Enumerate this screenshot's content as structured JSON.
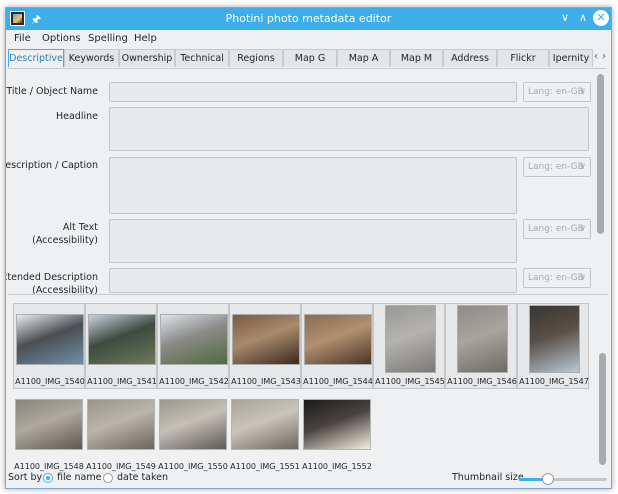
{
  "window": {
    "title": "Photini photo metadata editor",
    "pin_icon": "pin-icon",
    "app_icon": "photini-app-icon"
  },
  "menu": {
    "items": [
      "File",
      "Options",
      "Spelling",
      "Help"
    ]
  },
  "tabs": {
    "items": [
      "Descriptive",
      "Keywords",
      "Ownership",
      "Technical",
      "Regions",
      "Map G",
      "Map A",
      "Map M",
      "Address",
      "Flickr",
      "Ipernity"
    ],
    "active": "Descriptive"
  },
  "form": {
    "fields": [
      {
        "label": "Title / Object Name",
        "value": "",
        "lang": "Lang: en-GB"
      },
      {
        "label": "Headline",
        "value": ""
      },
      {
        "label": "Description / Caption",
        "value": "",
        "lang": "Lang: en-GB"
      },
      {
        "label": "Alt Text",
        "label2": "(Accessibility)",
        "value": "",
        "lang": "Lang: en-GB"
      },
      {
        "label": "Extended Description",
        "label2": "(Accessibility)",
        "value": "",
        "lang": "Lang: en-GB"
      }
    ]
  },
  "thumbnails": [
    {
      "name": "A1100_IMG_1540",
      "orientation": "landscape",
      "colors": [
        "#e8eaec",
        "#6e8fa8",
        "#4a4f52"
      ]
    },
    {
      "name": "A1100_IMG_1541",
      "orientation": "landscape",
      "colors": [
        "#c8d2dc",
        "#6b7a58",
        "#3e4a40"
      ]
    },
    {
      "name": "A1100_IMG_1542",
      "orientation": "landscape",
      "colors": [
        "#dde3ea",
        "#4f6a3c",
        "#8a8a86"
      ]
    },
    {
      "name": "A1100_IMG_1543",
      "orientation": "landscape",
      "colors": [
        "#7a5a44",
        "#3a2a20",
        "#a88a6c"
      ]
    },
    {
      "name": "A1100_IMG_1544",
      "orientation": "landscape",
      "colors": [
        "#8a6a52",
        "#4a3526",
        "#b09070"
      ]
    },
    {
      "name": "A1100_IMG_1545",
      "orientation": "portrait",
      "colors": [
        "#9a9894",
        "#7c7a76",
        "#b4b2ae"
      ]
    },
    {
      "name": "A1100_IMG_1546",
      "orientation": "portrait",
      "colors": [
        "#8e8a84",
        "#6e6a64",
        "#a8a49e"
      ]
    },
    {
      "name": "A1100_IMG_1547",
      "orientation": "portrait",
      "colors": [
        "#3a3430",
        "#b8c8d4",
        "#5a5048"
      ]
    },
    {
      "name": "A1100_IMG_1548",
      "orientation": "landscape",
      "colors": [
        "#8a847c",
        "#5e5850",
        "#b0a89e"
      ]
    },
    {
      "name": "A1100_IMG_1549",
      "orientation": "landscape",
      "colors": [
        "#9a948a",
        "#6a645c",
        "#bab4aa"
      ]
    },
    {
      "name": "A1100_IMG_1550",
      "orientation": "landscape",
      "colors": [
        "#9a968e",
        "#5e5a54",
        "#c4c0b8"
      ]
    },
    {
      "name": "A1100_IMG_1551",
      "orientation": "landscape",
      "colors": [
        "#a8a49c",
        "#6c6860",
        "#c8c4bc"
      ]
    },
    {
      "name": "A1100_IMG_1552",
      "orientation": "landscape",
      "colors": [
        "#1c1a18",
        "#f4f0e0",
        "#4a4440"
      ]
    }
  ],
  "status": {
    "sort_label": "Sort by",
    "sort_options": [
      "file name",
      "date taken"
    ],
    "sort_selected": "file name",
    "thumb_size_label": "Thumbnail size",
    "thumb_size_level": 0.3
  },
  "colors": {
    "accent": "#3daee9",
    "window_bg": "#eff0f1"
  }
}
